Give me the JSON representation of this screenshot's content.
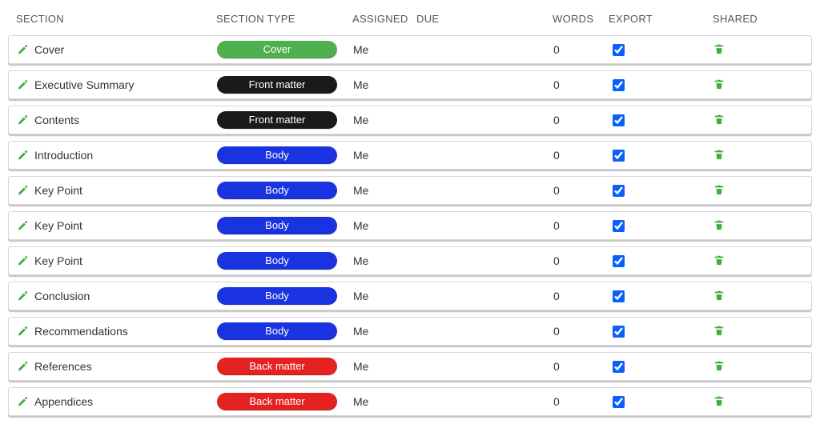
{
  "headers": {
    "section": "SECTION",
    "section_type": "SECTION TYPE",
    "assigned": "ASSIGNED",
    "due": "DUE",
    "words": "WORDS",
    "export": "EXPORT",
    "shared": "SHARED"
  },
  "type_labels": {
    "cover": "Cover",
    "front_matter": "Front matter",
    "body": "Body",
    "back_matter": "Back matter"
  },
  "type_colors": {
    "cover": "#4fb04f",
    "front_matter": "#1a1a1a",
    "body": "#1933e0",
    "back_matter": "#e52222"
  },
  "rows": [
    {
      "name": "Cover",
      "type": "cover",
      "assigned": "Me",
      "due": "",
      "words": 0,
      "export": true
    },
    {
      "name": "Executive Summary",
      "type": "front_matter",
      "assigned": "Me",
      "due": "",
      "words": 0,
      "export": true
    },
    {
      "name": "Contents",
      "type": "front_matter",
      "assigned": "Me",
      "due": "",
      "words": 0,
      "export": true
    },
    {
      "name": "Introduction",
      "type": "body",
      "assigned": "Me",
      "due": "",
      "words": 0,
      "export": true
    },
    {
      "name": "Key Point",
      "type": "body",
      "assigned": "Me",
      "due": "",
      "words": 0,
      "export": true
    },
    {
      "name": "Key Point",
      "type": "body",
      "assigned": "Me",
      "due": "",
      "words": 0,
      "export": true
    },
    {
      "name": "Key Point",
      "type": "body",
      "assigned": "Me",
      "due": "",
      "words": 0,
      "export": true
    },
    {
      "name": "Conclusion",
      "type": "body",
      "assigned": "Me",
      "due": "",
      "words": 0,
      "export": true
    },
    {
      "name": "Recommendations",
      "type": "body",
      "assigned": "Me",
      "due": "",
      "words": 0,
      "export": true
    },
    {
      "name": "References",
      "type": "back_matter",
      "assigned": "Me",
      "due": "",
      "words": 0,
      "export": true
    },
    {
      "name": "Appendices",
      "type": "back_matter",
      "assigned": "Me",
      "due": "",
      "words": 0,
      "export": true
    }
  ]
}
